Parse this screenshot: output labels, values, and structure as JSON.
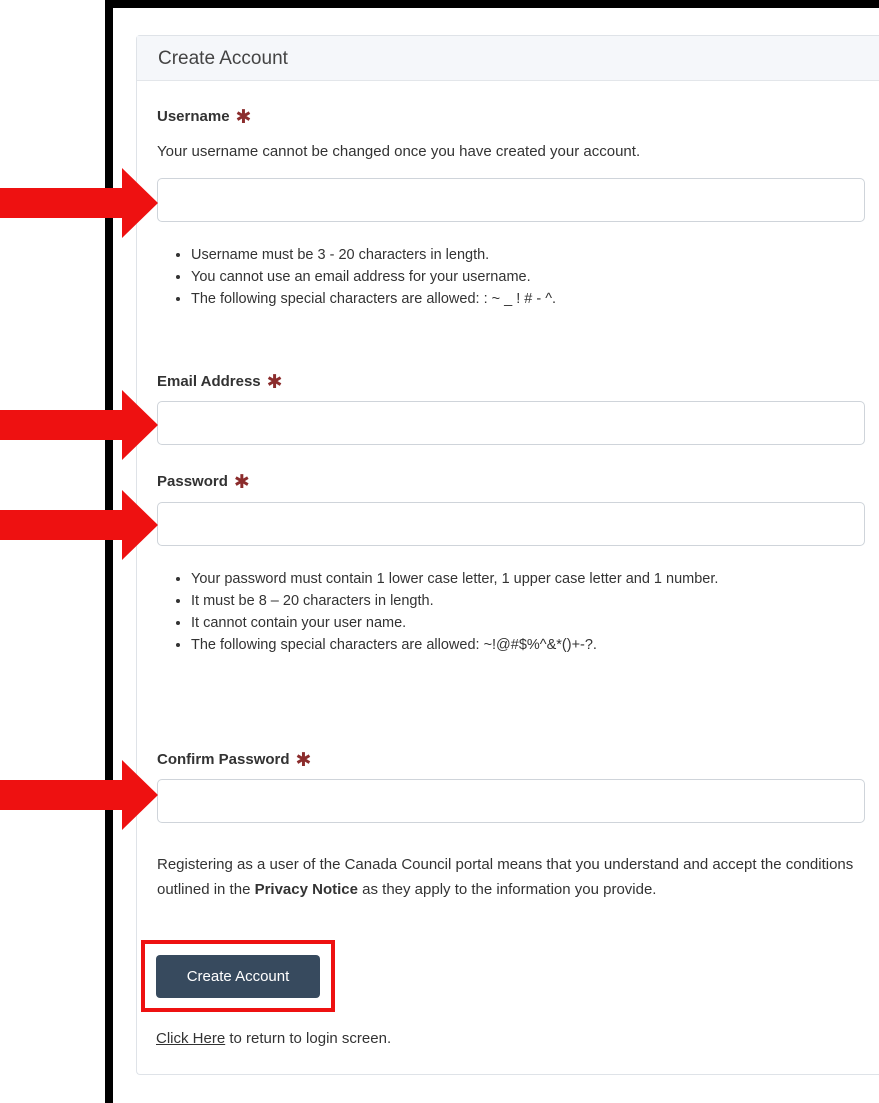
{
  "form": {
    "header": "Create Account",
    "username": {
      "label": "Username",
      "required_mark": "✱",
      "help": "Your username cannot be changed once you have created your account.",
      "value": "",
      "rules": [
        "Username must be 3 - 20 characters in length.",
        "You cannot use an email address for your username.",
        "The following special characters are allowed: : ~ _ ! # - ^."
      ]
    },
    "email": {
      "label": "Email Address",
      "required_mark": "✱",
      "value": ""
    },
    "password": {
      "label": "Password",
      "required_mark": "✱",
      "value": "",
      "rules": [
        "Your password must contain 1 lower case letter, 1 upper case letter and 1 number.",
        "It must be 8 – 20 characters in length.",
        "It cannot contain your user name.",
        "The following special characters are allowed: ~!@#$%^&*()+-?."
      ]
    },
    "confirm_password": {
      "label": "Confirm Password",
      "required_mark": "✱",
      "value": ""
    },
    "consent": {
      "before": "Registering as a user of the Canada Council portal means that you understand and accept the conditions outlined in the ",
      "link": "Privacy Notice",
      "after": " as they apply to the information you provide."
    },
    "submit_label": "Create Account",
    "footer": {
      "link": "Click Here",
      "text": " to return to login screen."
    }
  },
  "annotations": {
    "arrow_color": "#ee1111",
    "box_color": "#ee1111"
  }
}
